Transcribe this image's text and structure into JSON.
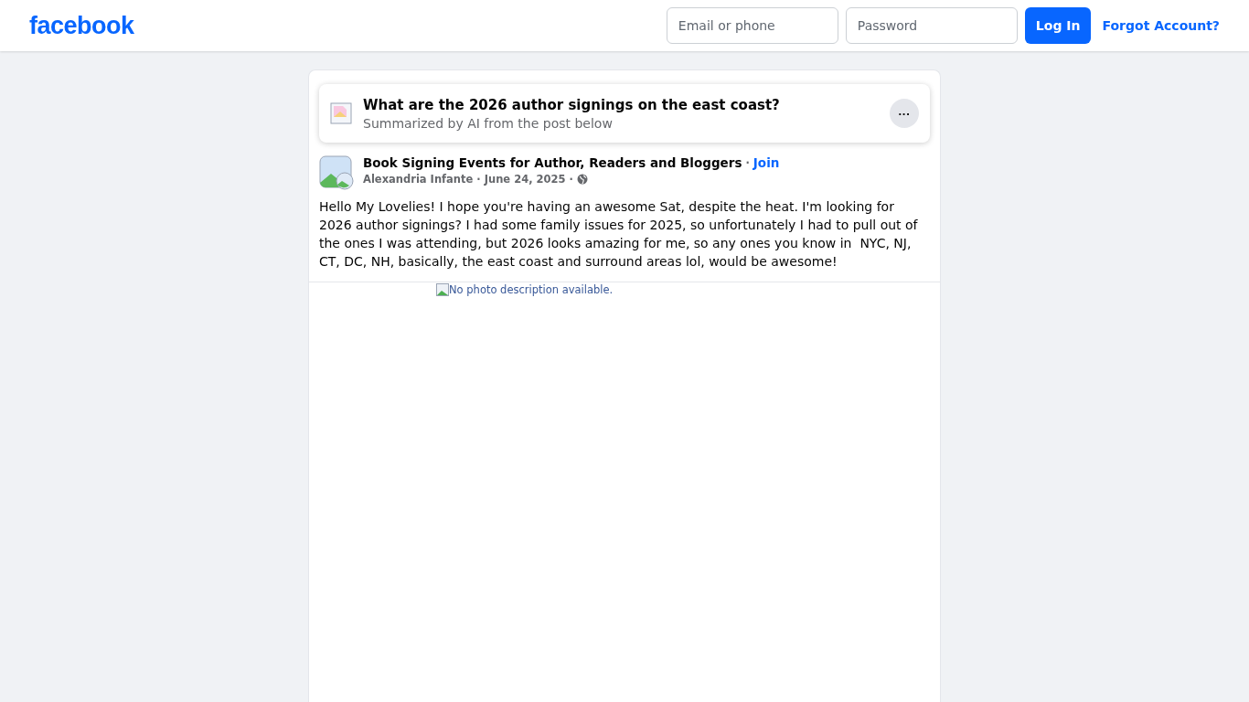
{
  "header": {
    "logo": "facebook",
    "email": {
      "placeholder": "Email or phone"
    },
    "password": {
      "placeholder": "Password"
    },
    "login_button": "Log In",
    "forgot_link": "Forgot Account?"
  },
  "summary": {
    "title": "What are the 2026 author signings on the east coast?",
    "subtitle": "Summarized by AI from the post below",
    "more_button": "···"
  },
  "post": {
    "group": "Book Signing Events for Author, Readers and Bloggers",
    "separator": "·",
    "join": "Join",
    "author": "Alexandria Infante",
    "date": "June 24, 2025",
    "meta_separator": "·",
    "body": "Hello My Lovelies! I hope you're having an awesome Sat, despite the heat. I'm looking for 2026 author signings? I had some family issues for 2025, so unfortunately I had to pull out of the ones I was attending, but 2026 looks amazing for me, so any ones you know in  NYC, NJ, CT, DC, NH, basically, the east coast and surround areas lol, would be awesome!",
    "image_alt": "No photo description available."
  }
}
